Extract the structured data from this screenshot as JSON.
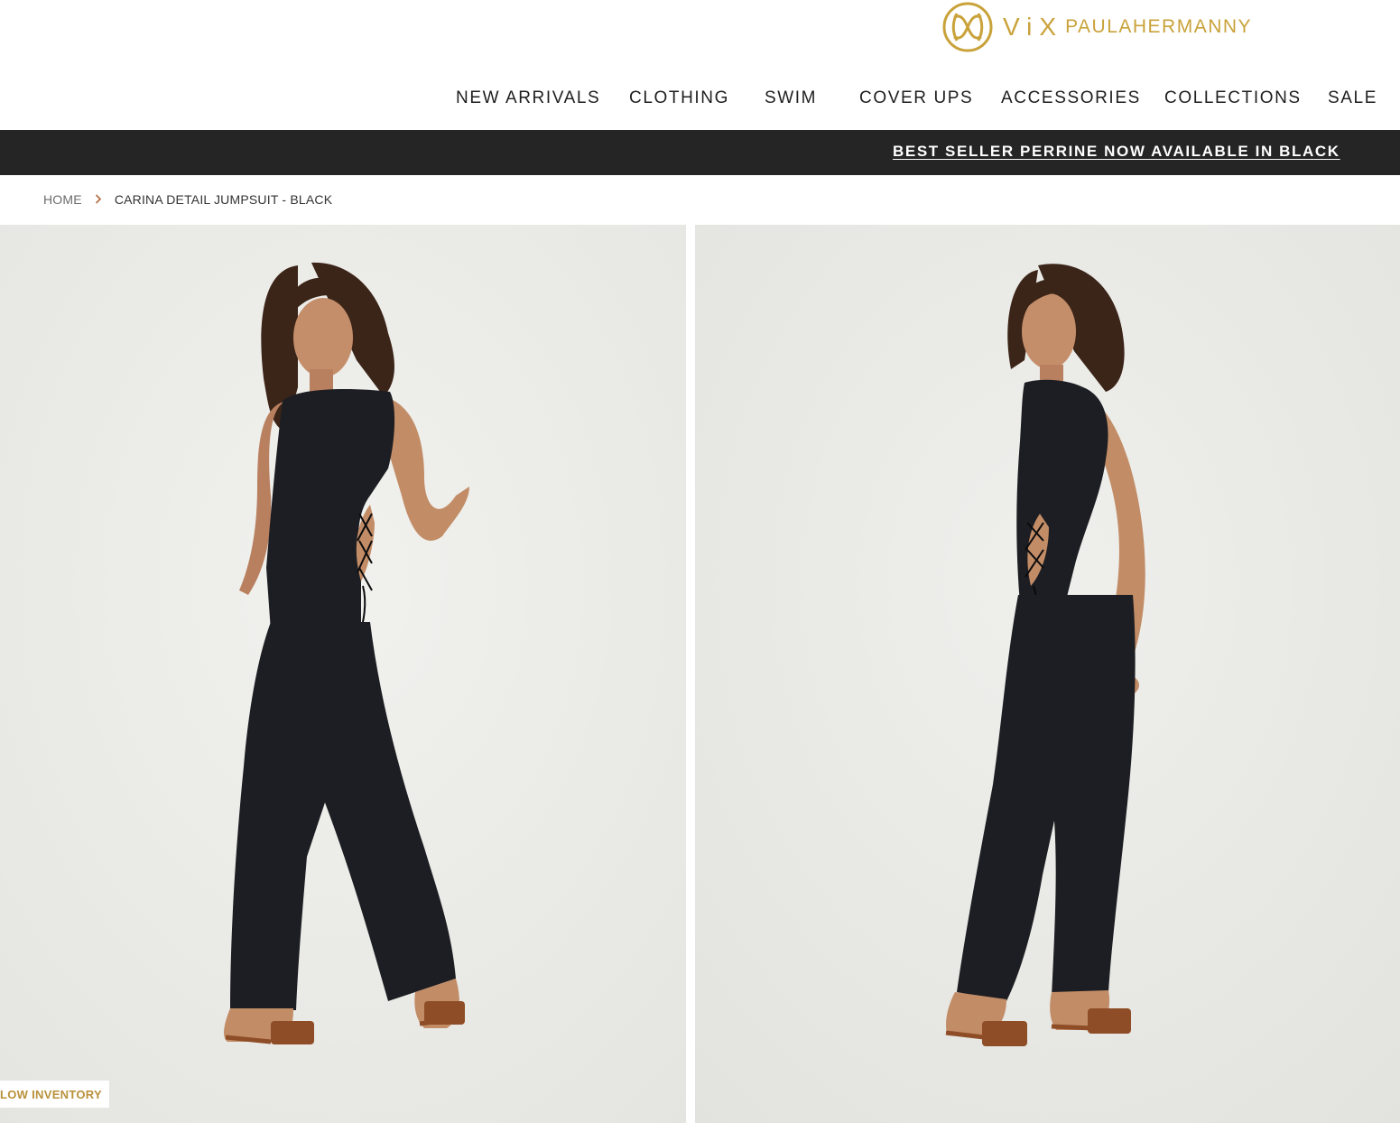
{
  "brand": {
    "logo_mark": "vix-monogram-icon",
    "wordmark": "ViX",
    "name": "PAULAHERMANNY",
    "color": "#c9a23a"
  },
  "nav": {
    "items": [
      {
        "label": "NEW ARRIVALS"
      },
      {
        "label": "CLOTHING"
      },
      {
        "label": "SWIM"
      },
      {
        "label": "COVER UPS"
      },
      {
        "label": "ACCESSORIES"
      },
      {
        "label": "COLLECTIONS"
      },
      {
        "label": "SALE"
      }
    ]
  },
  "announcement": {
    "text": "BEST SELLER PERRINE NOW AVAILABLE IN BLACK",
    "background": "#252525"
  },
  "breadcrumb": {
    "home": "HOME",
    "separator_icon": "chevron-right-icon",
    "current": "CARINA DETAIL JUMPSUIT - BLACK"
  },
  "gallery": {
    "images": [
      {
        "name": "product-photo-front"
      },
      {
        "name": "product-photo-side"
      }
    ],
    "badge": "LOW INVENTORY"
  }
}
